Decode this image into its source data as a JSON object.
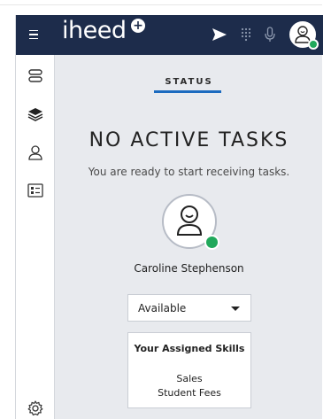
{
  "app": {
    "logo_text": "iheed",
    "logo_badge": "+"
  },
  "topbar": {
    "menu_icon": "hamburger-icon",
    "icons": [
      "send-icon",
      "dialpad-icon",
      "microphone-icon",
      "user-avatar-icon"
    ],
    "avatar_status": "online"
  },
  "sidebar": {
    "items": [
      {
        "icon": "queue-icon"
      },
      {
        "icon": "layers-icon"
      },
      {
        "icon": "contacts-icon"
      },
      {
        "icon": "list-card-icon"
      }
    ],
    "bottom_icon": "settings-icon"
  },
  "main": {
    "tab_label": "STATUS",
    "title": "NO ACTIVE TASKS",
    "subtitle": "You are ready to start receiving tasks.",
    "user_name": "Caroline Stephenson",
    "status_select": {
      "value": "Available"
    },
    "skills": {
      "title": "Your Assigned Skills",
      "items": [
        "Sales",
        "Student Fees"
      ]
    }
  },
  "colors": {
    "topbar": "#1d2c4b",
    "accent": "#1c6bbf",
    "online": "#21a85b",
    "background": "#e8eaee"
  }
}
